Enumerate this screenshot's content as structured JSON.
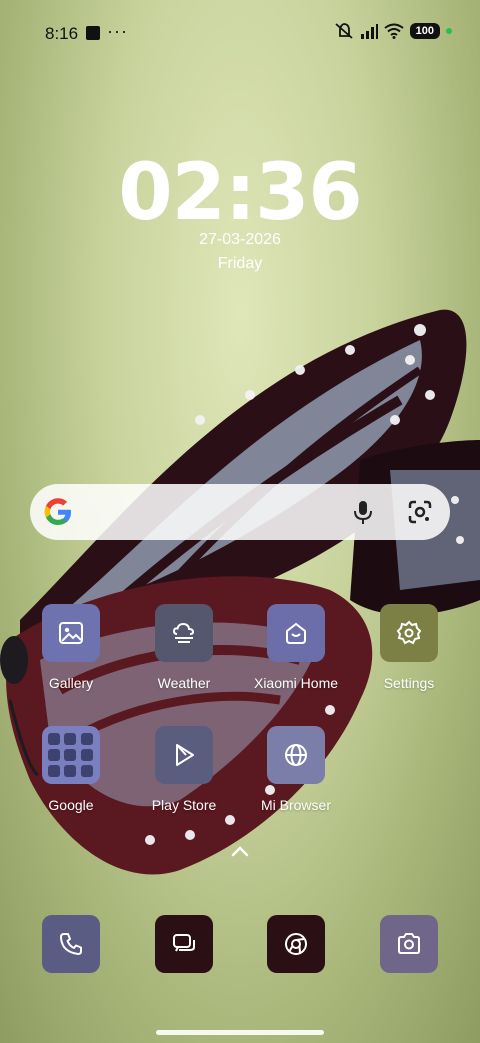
{
  "status_bar": {
    "time": "8:16",
    "more": "···",
    "battery": "100",
    "icons": [
      "square-notification-icon",
      "mute-icon",
      "signal-icon",
      "wifi-icon",
      "battery-icon",
      "dot-indicator"
    ]
  },
  "lock": {
    "clock": "02:36",
    "date": "27-03-2026",
    "day": "Friday"
  },
  "search": {
    "icons": [
      "google-logo",
      "mic-icon",
      "google-lens-icon"
    ]
  },
  "apps": [
    {
      "label": "Gallery",
      "icon": "gallery-icon"
    },
    {
      "label": "Weather",
      "icon": "weather-icon"
    },
    {
      "label": "Xiaomi Home",
      "icon": "xiaomi-home-icon"
    },
    {
      "label": "Settings",
      "icon": "gear-icon"
    },
    {
      "label": "Google",
      "icon": "google-folder-icon"
    },
    {
      "label": "Play Store",
      "icon": "play-store-icon"
    },
    {
      "label": "Mi Browser",
      "icon": "globe-icon"
    }
  ],
  "dock": [
    "phone-icon",
    "messages-icon",
    "chrome-icon",
    "camera-icon"
  ],
  "colors": {
    "gallery": "#6e73b0",
    "weather": "#55576e",
    "settings": "#7d8045",
    "dock_dark": "#2a1015"
  }
}
